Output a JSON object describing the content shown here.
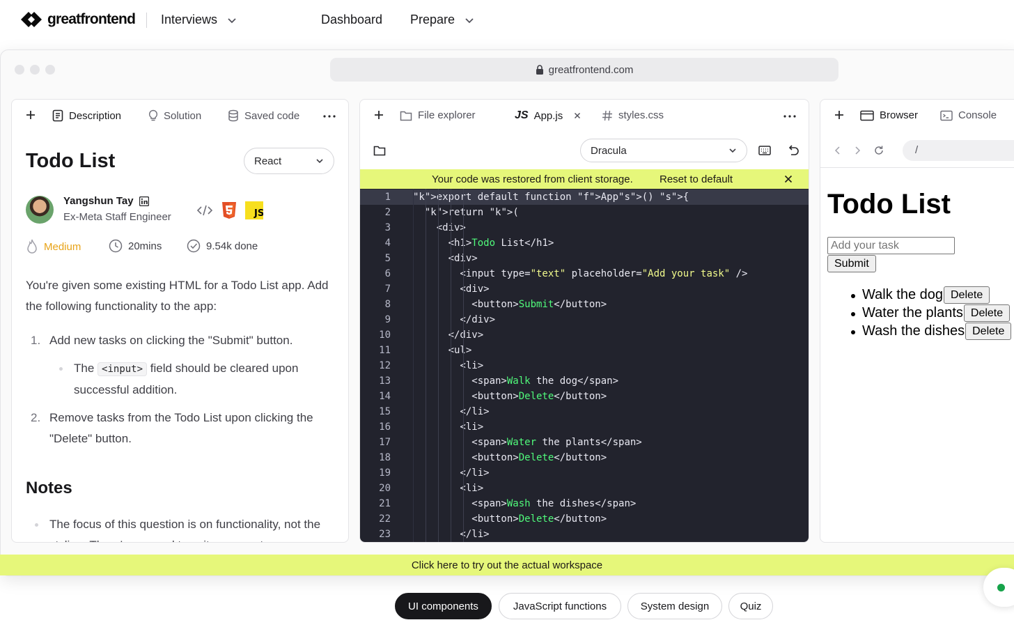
{
  "nav": {
    "brand": "greatfrontend",
    "items": [
      {
        "label": "Interviews",
        "has_chevron": true
      },
      {
        "label": "Dashboard",
        "has_chevron": false
      },
      {
        "label": "Prepare",
        "has_chevron": true
      }
    ]
  },
  "browser": {
    "url": "greatfrontend.com"
  },
  "description_panel": {
    "tabs": [
      "Description",
      "Solution",
      "Saved code"
    ],
    "title": "Todo List",
    "framework": "React",
    "author": {
      "name": "Yangshun Tay",
      "role": "Ex-Meta Staff Engineer"
    },
    "tech_icons": [
      "code-icon",
      "html5-icon",
      "js-icon"
    ],
    "difficulty": "Medium",
    "duration": "20mins",
    "completed": "9.54k done",
    "intro": "You're given some existing HTML for a Todo List app. Add the following functionality to the app:",
    "steps": [
      {
        "num": "1.",
        "text": "Add new tasks on clicking the \"Submit\" button."
      },
      {
        "num": "2.",
        "text": "Remove tasks from the Todo List upon clicking the \"Delete\" button."
      }
    ],
    "sub_step": {
      "prefix": "The",
      "code": "<input>",
      "suffix": "field should be cleared upon successful addition."
    },
    "notes_heading": "Notes",
    "notes": [
      "The focus of this question is on functionality, not the styling. There's no need to write any custom"
    ]
  },
  "editor_panel": {
    "tabs": [
      "File explorer",
      "App.js",
      "styles.css"
    ],
    "js_badge": "JS",
    "theme": "Dracula",
    "banner_text": "Your code was restored from client storage.",
    "banner_action": "Reset to default",
    "code_lines": [
      "export default function App() {",
      "  return (",
      "    <div>",
      "      <h1>Todo List</h1>",
      "      <div>",
      "        <input type=\"text\" placeholder=\"Add your task\" />",
      "        <div>",
      "          <button>Submit</button>",
      "        </div>",
      "      </div>",
      "      <ul>",
      "        <li>",
      "          <span>Walk the dog</span>",
      "          <button>Delete</button>",
      "        </li>",
      "        <li>",
      "          <span>Water the plants</span>",
      "          <button>Delete</button>",
      "        </li>",
      "        <li>",
      "          <span>Wash the dishes</span>",
      "          <button>Delete</button>",
      "        </li>"
    ],
    "line_numbers": [
      "1",
      "2",
      "3",
      "4",
      "5",
      "6",
      "7",
      "8",
      "9",
      "10",
      "11",
      "12",
      "13",
      "14",
      "15",
      "16",
      "17",
      "18",
      "19",
      "20",
      "21",
      "22",
      "23"
    ]
  },
  "preview_panel": {
    "tabs": [
      "Browser",
      "Console"
    ],
    "address": "/",
    "heading": "Todo List",
    "input_placeholder": "Add your task",
    "submit_label": "Submit",
    "delete_label": "Delete",
    "tasks": [
      "Walk the dog",
      "Water the plants",
      "Wash the dishes"
    ]
  },
  "cta": "Click here to try out the actual workspace",
  "categories": [
    {
      "label": "UI components",
      "active": true
    },
    {
      "label": "JavaScript functions",
      "active": false
    },
    {
      "label": "System design",
      "active": false
    },
    {
      "label": "Quiz",
      "active": false
    }
  ],
  "colors": {
    "accent_banner": "#e6f77a",
    "editor_bg": "#22232d",
    "difficulty": "#e8a317",
    "status_dot": "#16a34a"
  }
}
